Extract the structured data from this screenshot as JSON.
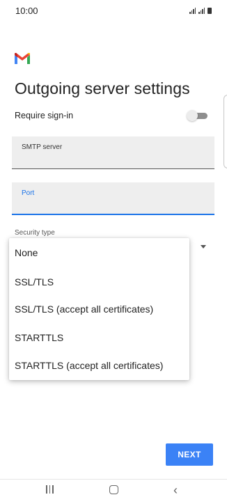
{
  "status_bar": {
    "time": "10:00",
    "signal_icon": "signal-icon",
    "battery_icon": "battery-icon"
  },
  "app": {
    "logo": "gmail-logo-icon",
    "title": "Outgoing server settings"
  },
  "form": {
    "require_signin_label": "Require sign-in",
    "require_signin_on": false,
    "smtp_label": "SMTP server",
    "smtp_value": "",
    "port_label": "Port",
    "port_value": "",
    "security_type_label": "Security type"
  },
  "dropdown": {
    "options": [
      "None",
      "SSL/TLS",
      "SSL/TLS (accept all certificates)",
      "STARTTLS",
      "STARTTLS (accept all certificates)"
    ]
  },
  "actions": {
    "next_label": "NEXT"
  },
  "colors": {
    "accent": "#1a73e8",
    "button": "#3b82f6"
  }
}
